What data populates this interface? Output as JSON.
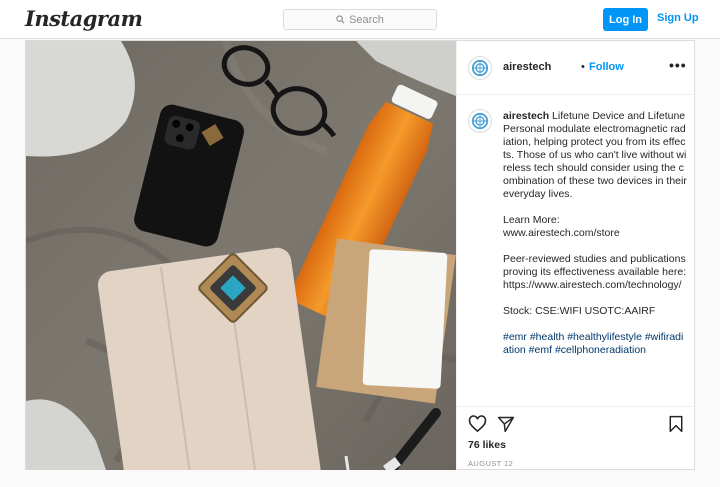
{
  "header": {
    "logo": "Instagram",
    "search_placeholder": "Search",
    "login_label": "Log In",
    "signup_label": "Sign Up"
  },
  "post": {
    "username": "airestech",
    "separator": "•",
    "follow_label": "Follow",
    "more_label": "•••",
    "caption": {
      "username": "airestech",
      "body": "Lifetune Device and Lifetune Personal modulate electromagnetic radiation, helping protect you from its effects. Those of us who can't live without wireless tech should consider using the combination of these two devices in their everyday lives.",
      "learn_more_label": "Learn More:",
      "learn_more_url": "www.airestech.com/store",
      "studies_text": "Peer-reviewed studies and publications proving its effectiveness available here:",
      "studies_url": "https://www.airestech.com/technology/",
      "stock": "Stock: CSE:WIFI USOTC:AAIRF",
      "hashtags": "#emr #health #healthylifestyle #wifiradiation #emf #cellphoneradiation"
    },
    "likes": "76 likes",
    "date": "AUGUST 12"
  },
  "colors": {
    "accent": "#0095f6",
    "hashtag": "#00376b",
    "border": "#dbdbdb",
    "muted": "#8e8e8e"
  },
  "icons": {
    "search": "search-icon",
    "like": "heart-icon",
    "share": "paper-plane-icon",
    "save": "bookmark-icon",
    "avatar": "airestech-logo-icon"
  }
}
